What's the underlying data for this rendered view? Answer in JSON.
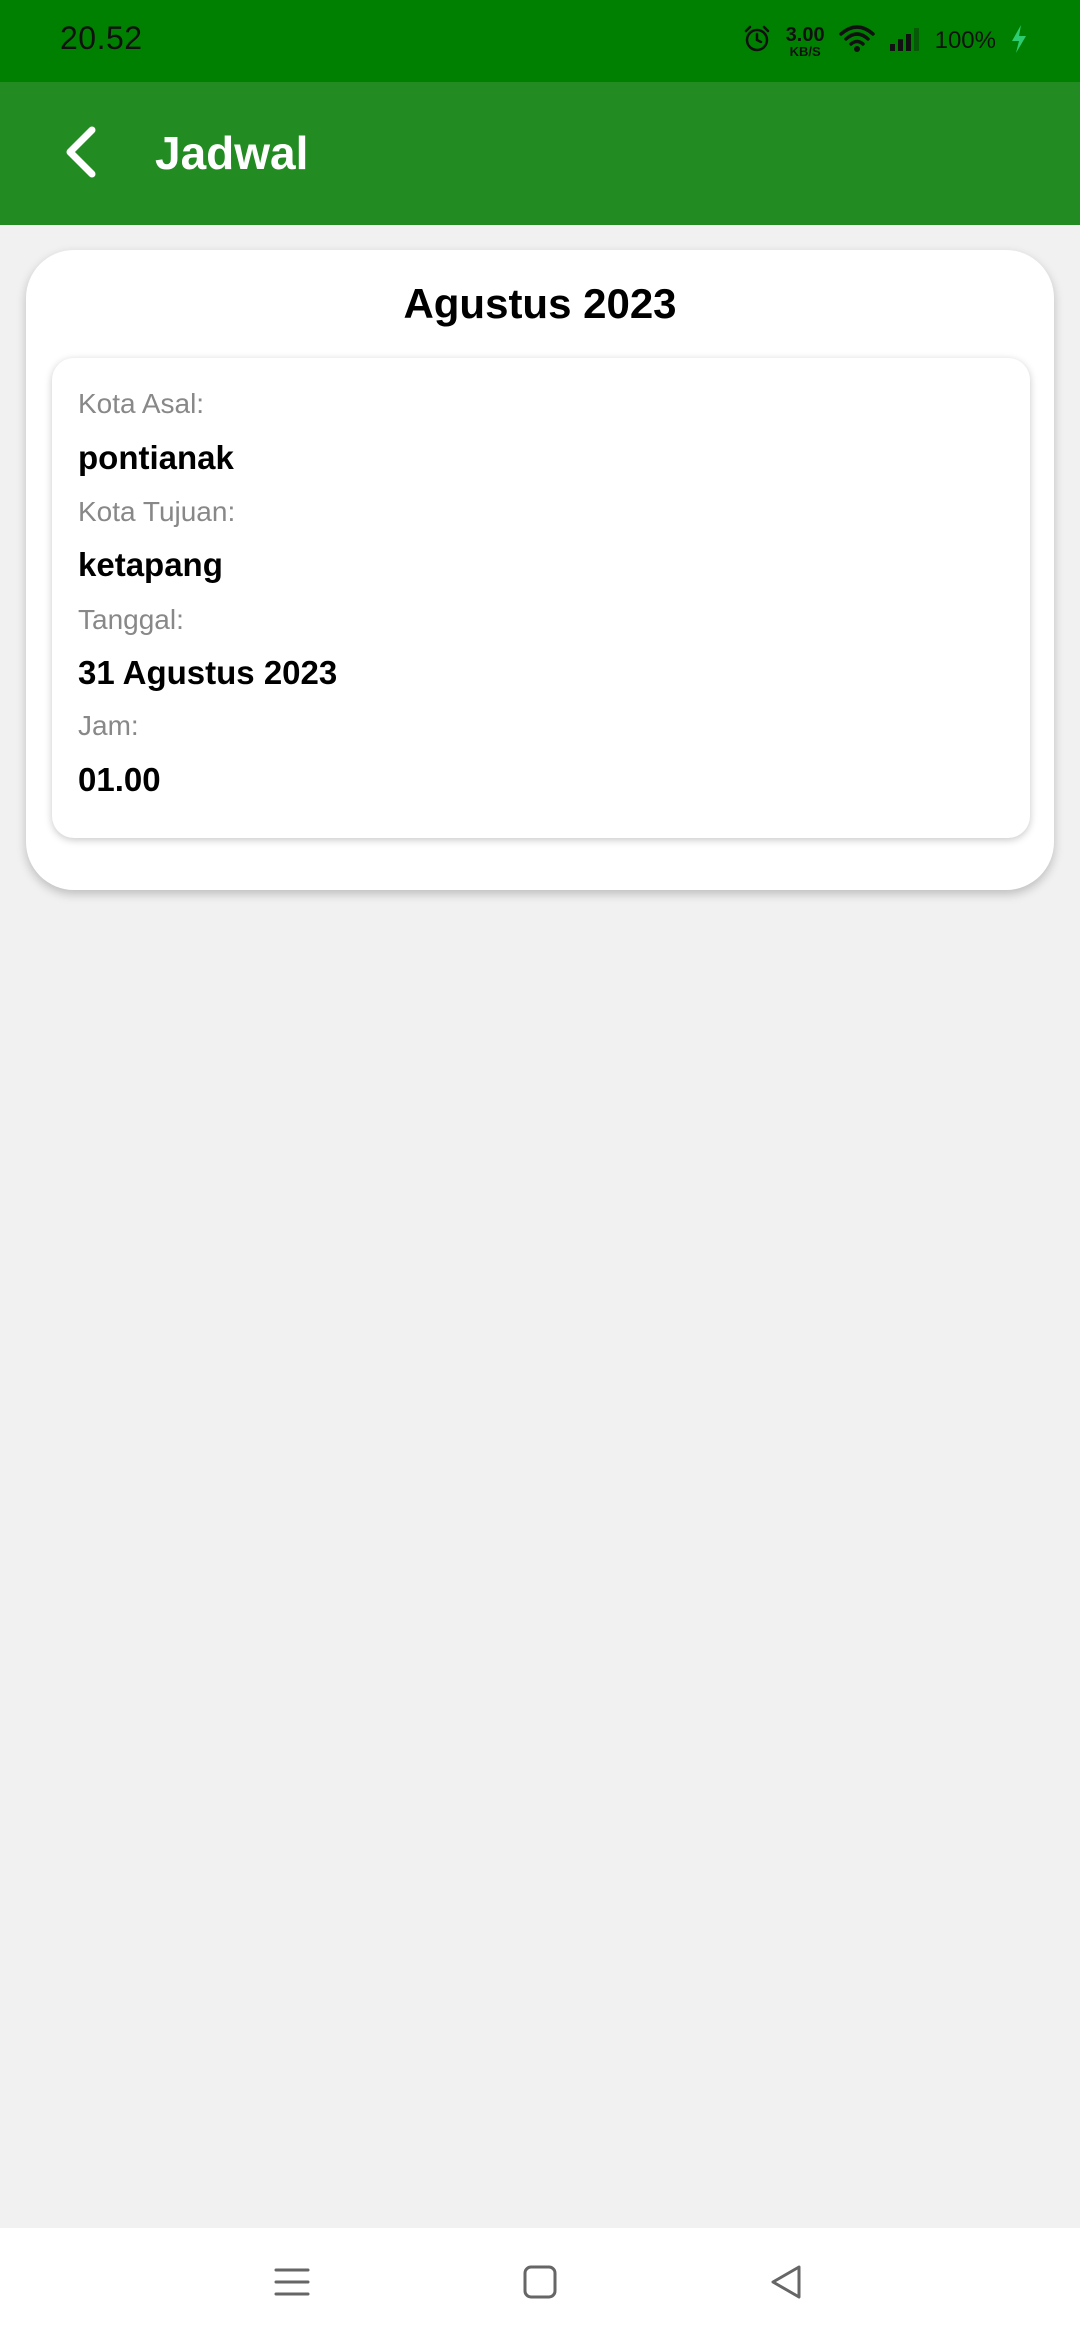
{
  "status_bar": {
    "time": "20.52",
    "net_speed_value": "3.00",
    "net_speed_unit": "KB/S",
    "battery": "100%",
    "icons": [
      "alarm-icon",
      "wifi-icon",
      "signal-icon",
      "charging-icon"
    ]
  },
  "app_bar": {
    "title": "Jadwal",
    "back_icon": "back-arrow-icon"
  },
  "schedule": {
    "month": "Agustus 2023",
    "origin_label": "Kota Asal:",
    "origin_value": "pontianak",
    "destination_label": "Kota Tujuan:",
    "destination_value": "ketapang",
    "date_label": "Tanggal:",
    "date_value": "31 Agustus 2023",
    "time_label": "Jam:",
    "time_value": "01.00"
  },
  "nav_bar": {
    "icons": [
      "menu-icon",
      "home-icon",
      "back-icon"
    ]
  },
  "colors": {
    "status_bar": "#008000",
    "app_bar": "#228b22",
    "background": "#f1f1f1",
    "charging": "#2ecc71"
  }
}
